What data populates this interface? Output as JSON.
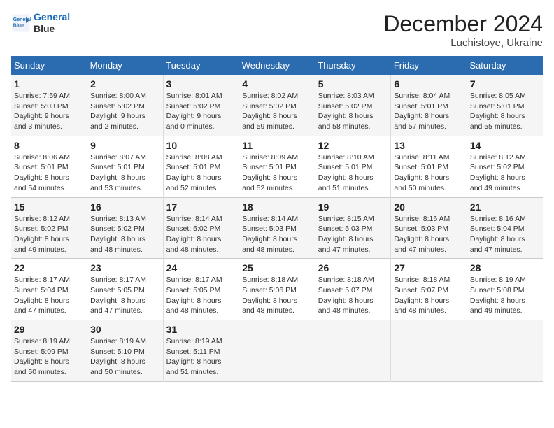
{
  "header": {
    "logo_line1": "General",
    "logo_line2": "Blue",
    "month": "December 2024",
    "location": "Luchistoye, Ukraine"
  },
  "weekdays": [
    "Sunday",
    "Monday",
    "Tuesday",
    "Wednesday",
    "Thursday",
    "Friday",
    "Saturday"
  ],
  "weeks": [
    [
      {
        "day": "1",
        "info": "Sunrise: 7:59 AM\nSunset: 5:03 PM\nDaylight: 9 hours\nand 3 minutes."
      },
      {
        "day": "2",
        "info": "Sunrise: 8:00 AM\nSunset: 5:02 PM\nDaylight: 9 hours\nand 2 minutes."
      },
      {
        "day": "3",
        "info": "Sunrise: 8:01 AM\nSunset: 5:02 PM\nDaylight: 9 hours\nand 0 minutes."
      },
      {
        "day": "4",
        "info": "Sunrise: 8:02 AM\nSunset: 5:02 PM\nDaylight: 8 hours\nand 59 minutes."
      },
      {
        "day": "5",
        "info": "Sunrise: 8:03 AM\nSunset: 5:02 PM\nDaylight: 8 hours\nand 58 minutes."
      },
      {
        "day": "6",
        "info": "Sunrise: 8:04 AM\nSunset: 5:01 PM\nDaylight: 8 hours\nand 57 minutes."
      },
      {
        "day": "7",
        "info": "Sunrise: 8:05 AM\nSunset: 5:01 PM\nDaylight: 8 hours\nand 55 minutes."
      }
    ],
    [
      {
        "day": "8",
        "info": "Sunrise: 8:06 AM\nSunset: 5:01 PM\nDaylight: 8 hours\nand 54 minutes."
      },
      {
        "day": "9",
        "info": "Sunrise: 8:07 AM\nSunset: 5:01 PM\nDaylight: 8 hours\nand 53 minutes."
      },
      {
        "day": "10",
        "info": "Sunrise: 8:08 AM\nSunset: 5:01 PM\nDaylight: 8 hours\nand 52 minutes."
      },
      {
        "day": "11",
        "info": "Sunrise: 8:09 AM\nSunset: 5:01 PM\nDaylight: 8 hours\nand 52 minutes."
      },
      {
        "day": "12",
        "info": "Sunrise: 8:10 AM\nSunset: 5:01 PM\nDaylight: 8 hours\nand 51 minutes."
      },
      {
        "day": "13",
        "info": "Sunrise: 8:11 AM\nSunset: 5:01 PM\nDaylight: 8 hours\nand 50 minutes."
      },
      {
        "day": "14",
        "info": "Sunrise: 8:12 AM\nSunset: 5:02 PM\nDaylight: 8 hours\nand 49 minutes."
      }
    ],
    [
      {
        "day": "15",
        "info": "Sunrise: 8:12 AM\nSunset: 5:02 PM\nDaylight: 8 hours\nand 49 minutes."
      },
      {
        "day": "16",
        "info": "Sunrise: 8:13 AM\nSunset: 5:02 PM\nDaylight: 8 hours\nand 48 minutes."
      },
      {
        "day": "17",
        "info": "Sunrise: 8:14 AM\nSunset: 5:02 PM\nDaylight: 8 hours\nand 48 minutes."
      },
      {
        "day": "18",
        "info": "Sunrise: 8:14 AM\nSunset: 5:03 PM\nDaylight: 8 hours\nand 48 minutes."
      },
      {
        "day": "19",
        "info": "Sunrise: 8:15 AM\nSunset: 5:03 PM\nDaylight: 8 hours\nand 47 minutes."
      },
      {
        "day": "20",
        "info": "Sunrise: 8:16 AM\nSunset: 5:03 PM\nDaylight: 8 hours\nand 47 minutes."
      },
      {
        "day": "21",
        "info": "Sunrise: 8:16 AM\nSunset: 5:04 PM\nDaylight: 8 hours\nand 47 minutes."
      }
    ],
    [
      {
        "day": "22",
        "info": "Sunrise: 8:17 AM\nSunset: 5:04 PM\nDaylight: 8 hours\nand 47 minutes."
      },
      {
        "day": "23",
        "info": "Sunrise: 8:17 AM\nSunset: 5:05 PM\nDaylight: 8 hours\nand 47 minutes."
      },
      {
        "day": "24",
        "info": "Sunrise: 8:17 AM\nSunset: 5:05 PM\nDaylight: 8 hours\nand 48 minutes."
      },
      {
        "day": "25",
        "info": "Sunrise: 8:18 AM\nSunset: 5:06 PM\nDaylight: 8 hours\nand 48 minutes."
      },
      {
        "day": "26",
        "info": "Sunrise: 8:18 AM\nSunset: 5:07 PM\nDaylight: 8 hours\nand 48 minutes."
      },
      {
        "day": "27",
        "info": "Sunrise: 8:18 AM\nSunset: 5:07 PM\nDaylight: 8 hours\nand 48 minutes."
      },
      {
        "day": "28",
        "info": "Sunrise: 8:19 AM\nSunset: 5:08 PM\nDaylight: 8 hours\nand 49 minutes."
      }
    ],
    [
      {
        "day": "29",
        "info": "Sunrise: 8:19 AM\nSunset: 5:09 PM\nDaylight: 8 hours\nand 50 minutes."
      },
      {
        "day": "30",
        "info": "Sunrise: 8:19 AM\nSunset: 5:10 PM\nDaylight: 8 hours\nand 50 minutes."
      },
      {
        "day": "31",
        "info": "Sunrise: 8:19 AM\nSunset: 5:11 PM\nDaylight: 8 hours\nand 51 minutes."
      },
      {
        "day": "",
        "info": ""
      },
      {
        "day": "",
        "info": ""
      },
      {
        "day": "",
        "info": ""
      },
      {
        "day": "",
        "info": ""
      }
    ]
  ]
}
